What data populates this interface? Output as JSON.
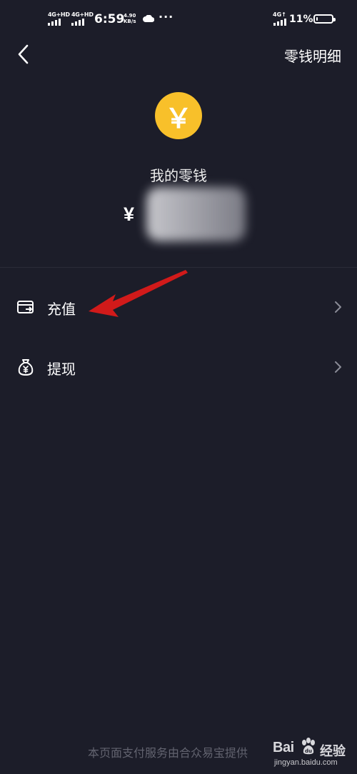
{
  "status_bar": {
    "sim1_network": "4G+HD",
    "sim2_network": "4G+HD",
    "time": "6:59",
    "speed_value": "4.90",
    "speed_unit": "KB/s",
    "weather_icon": "cloud-icon",
    "more": "···",
    "right_network": "4G↑",
    "battery_percent": "11%",
    "battery_level": 0.11
  },
  "nav": {
    "back_icon": "chevron-left-icon",
    "action_label": "零钱明细"
  },
  "balance": {
    "coin_symbol": "￥",
    "label": "我的零钱",
    "currency_symbol": "¥",
    "amount": "3"
  },
  "menu": {
    "items": [
      {
        "label": "充值",
        "icon": "card-transfer-icon"
      },
      {
        "label": "提现",
        "icon": "money-bag-icon"
      }
    ]
  },
  "footer": {
    "text": "本页面支付服务由合众易宝提供"
  },
  "watermark": {
    "brand_left": "Bai",
    "brand_right": "du",
    "brand_cn": "经验",
    "url": "jingyan.baidu.com"
  },
  "colors": {
    "background": "#1c1d29",
    "coin": "#f8c02a",
    "annotation_arrow": "#d11a1a",
    "footer_text": "#62636f"
  }
}
